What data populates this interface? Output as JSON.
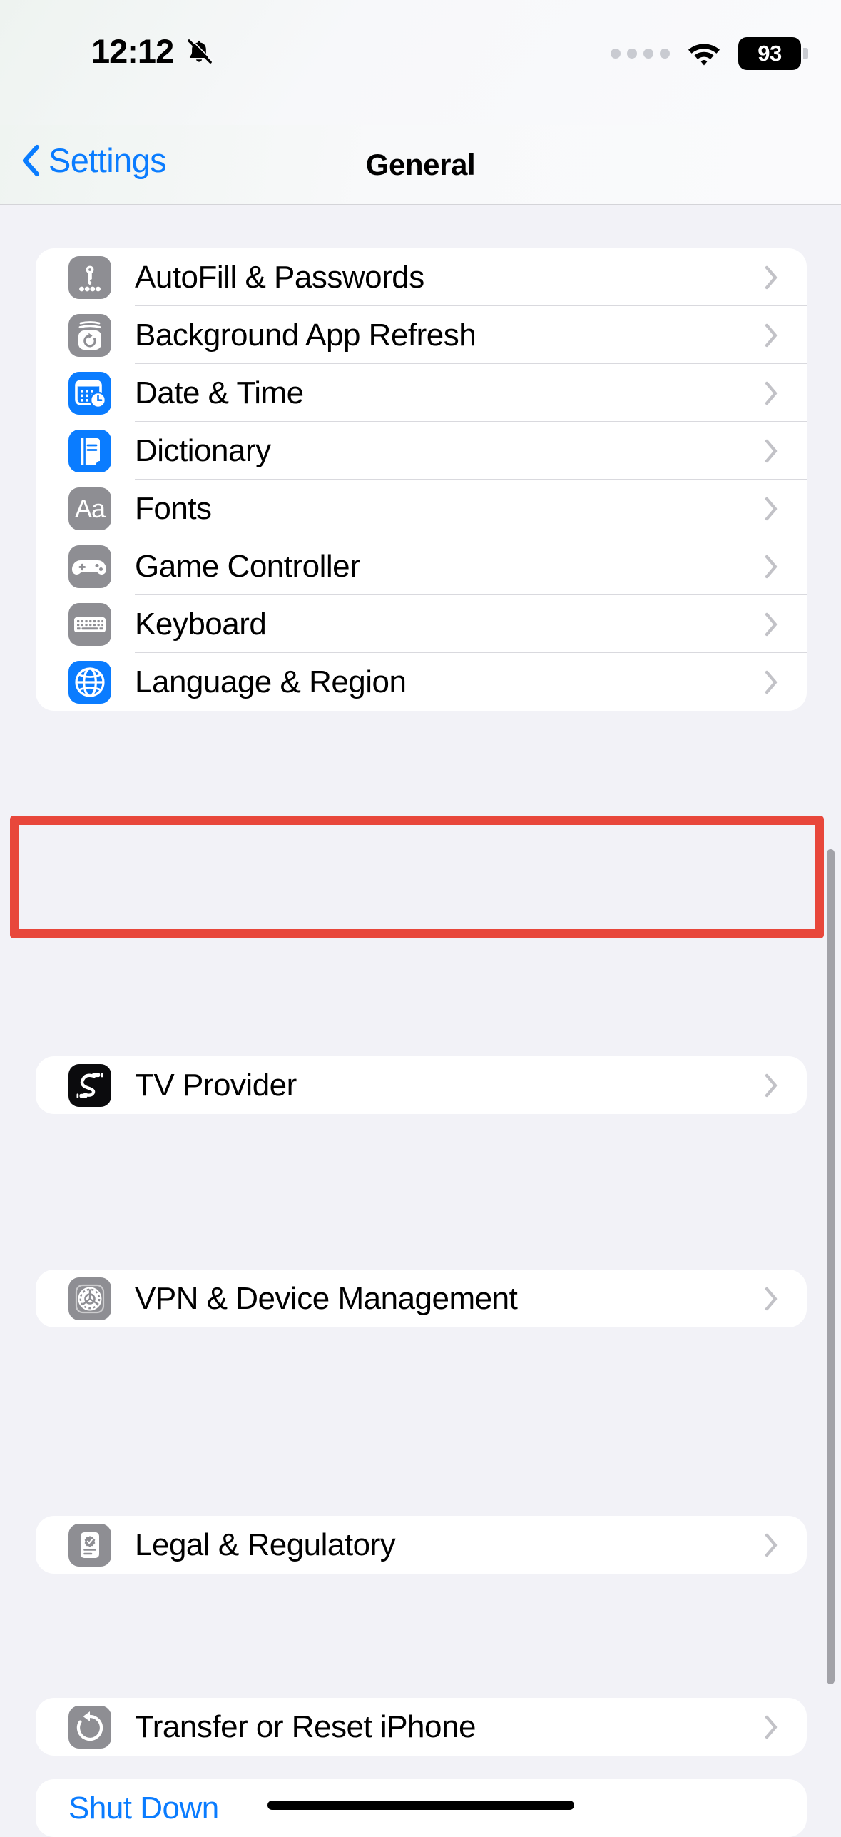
{
  "status_bar": {
    "time": "12:12",
    "bell_icon": "bell-slash-icon",
    "signal_icon": "cellular-dots-icon",
    "wifi_icon": "wifi-icon",
    "battery_level": "93"
  },
  "nav": {
    "back_label": "Settings",
    "back_icon": "chevron-left-icon",
    "title": "General"
  },
  "groups": [
    {
      "id": "group-general-options",
      "rows": [
        {
          "label": "AutoFill & Passwords",
          "icon": "key-passwords-icon",
          "icon_style": "gray",
          "accessory": "chevron-right-icon"
        },
        {
          "label": "Background App Refresh",
          "icon": "app-refresh-icon",
          "icon_style": "gray",
          "accessory": "chevron-right-icon"
        },
        {
          "label": "Date & Time",
          "icon": "calendar-clock-icon",
          "icon_style": "blue",
          "accessory": "chevron-right-icon"
        },
        {
          "label": "Dictionary",
          "icon": "book-icon",
          "icon_style": "blue",
          "accessory": "chevron-right-icon"
        },
        {
          "label": "Fonts",
          "icon": "aa-fonts-icon",
          "icon_style": "gray",
          "accessory": "chevron-right-icon"
        },
        {
          "label": "Game Controller",
          "icon": "gamepad-icon",
          "icon_style": "gray",
          "accessory": "chevron-right-icon"
        },
        {
          "label": "Keyboard",
          "icon": "keyboard-icon",
          "icon_style": "gray",
          "accessory": "chevron-right-icon"
        },
        {
          "label": "Language & Region",
          "icon": "globe-icon",
          "icon_style": "blue",
          "accessory": "chevron-right-icon"
        }
      ]
    },
    {
      "id": "group-tv-provider",
      "rows": [
        {
          "label": "TV Provider",
          "icon": "tv-provider-icon",
          "icon_style": "black",
          "accessory": "chevron-right-icon"
        }
      ]
    },
    {
      "id": "group-vpn",
      "rows": [
        {
          "label": "VPN & Device Management",
          "icon": "gear-icon",
          "icon_style": "gray",
          "accessory": "chevron-right-icon"
        }
      ]
    },
    {
      "id": "group-legal",
      "rows": [
        {
          "label": "Legal & Regulatory",
          "icon": "legal-document-icon",
          "icon_style": "gray",
          "accessory": "chevron-right-icon"
        }
      ]
    },
    {
      "id": "group-transfer",
      "rows": [
        {
          "label": "Transfer or Reset iPhone",
          "icon": "reset-arrow-icon",
          "icon_style": "gray",
          "accessory": "chevron-right-icon"
        }
      ]
    },
    {
      "id": "group-shutdown",
      "rows": [
        {
          "label": "Shut Down",
          "icon": "none",
          "icon_style": "none",
          "accessory": "none",
          "link": true
        }
      ]
    }
  ],
  "annotation": {
    "highlight_target": "Keyboard",
    "highlight_color": "#E8473B"
  },
  "colors": {
    "accent_blue": "#0A7CFF",
    "page_background": "#F2F2F7",
    "card_background": "#FFFFFF",
    "icon_gray": "#8E8E93",
    "icon_black": "#0B0B0D",
    "separator": "#D9D9DE",
    "chevron": "#C2C2C7"
  }
}
